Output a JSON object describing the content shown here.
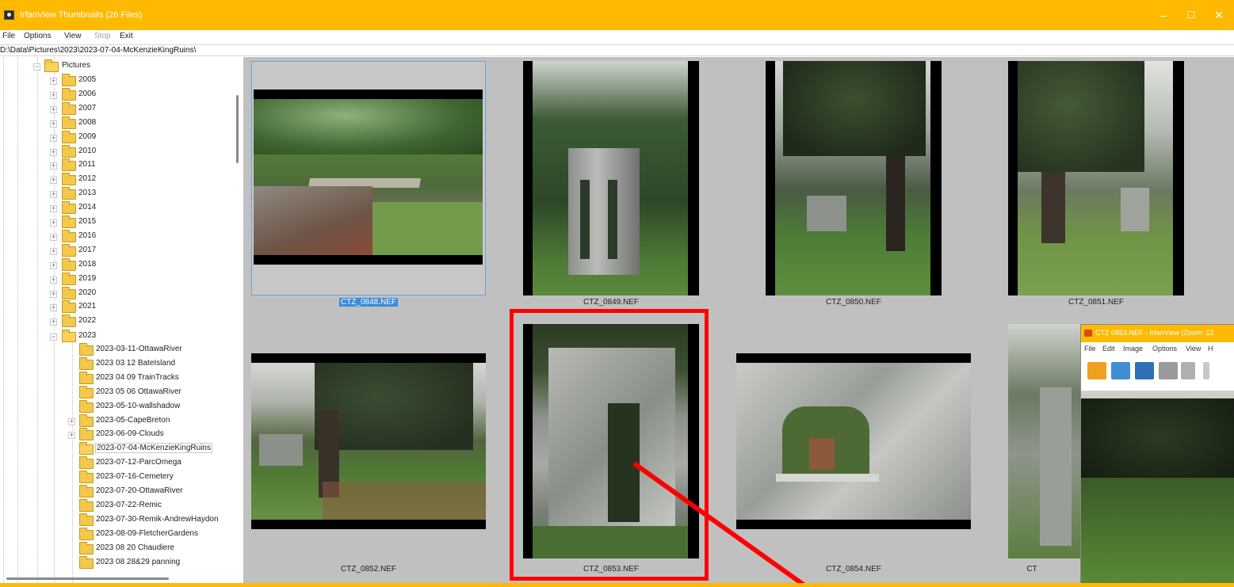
{
  "window": {
    "title": "IrfanView Thumbnails (26 Files)",
    "minimize_glyph": "–",
    "maximize_glyph": "☐",
    "close_glyph": "✕",
    "accent": "#ffb900"
  },
  "menu": {
    "file": "File",
    "options": "Options",
    "view": "View",
    "stop": "Stop",
    "exit": "Exit"
  },
  "path": "D:\\Data\\Pictures\\2023\\2023-07-04-McKenzieKingRuins\\",
  "tree": {
    "root": "Pictures",
    "years": [
      "2005",
      "2006",
      "2007",
      "2008",
      "2009",
      "2010",
      "2011",
      "2012",
      "2013",
      "2014",
      "2015",
      "2016",
      "2017",
      "2018",
      "2019",
      "2020",
      "2021",
      "2022"
    ],
    "open_year": "2023",
    "subfolders": [
      "2023-03-11-OttawaRiver",
      "2023 03 12 BateIsland",
      "2023 04 09 TrainTracks",
      "2023 05 06 OttawaRiver",
      "2023-05-10-wallshadow",
      "2023-05-CapeBreton",
      "2023-06-09-Clouds",
      "2023-07-04-McKenzieKingRuins",
      "2023-07-12-ParcOmega",
      "2023-07-16-Cemetery",
      "2023-07-20-OttawaRiver",
      "2023-07-22-Remic",
      "2023-07-30-Remik-AndrewHaydon",
      "2023-08-09-FletcherGardens",
      "2023 08 20 Chaudiere",
      "2023 08 28&29 panning"
    ],
    "selected_subfolder": "2023-07-04-McKenzieKingRuins"
  },
  "thumbnails": [
    {
      "name": "CTZ_0848.NEF",
      "selected": true
    },
    {
      "name": "CTZ_0849.NEF",
      "selected": false
    },
    {
      "name": "CTZ_0850.NEF",
      "selected": false
    },
    {
      "name": "CTZ_0851.NEF",
      "selected": false
    },
    {
      "name": "CTZ_0852.NEF",
      "selected": false
    },
    {
      "name": "CTZ_0853.NEF",
      "selected": false
    },
    {
      "name": "CTZ_0854.NEF",
      "selected": false
    },
    {
      "name": "CT",
      "selected": false
    }
  ],
  "popup": {
    "title": "CTZ 0853.NEF - IrfanView (Zoom: 12",
    "menu": [
      "File",
      "Edit",
      "Image",
      "Options",
      "View",
      "H"
    ]
  },
  "annotation": {
    "color": "#ff0000"
  }
}
